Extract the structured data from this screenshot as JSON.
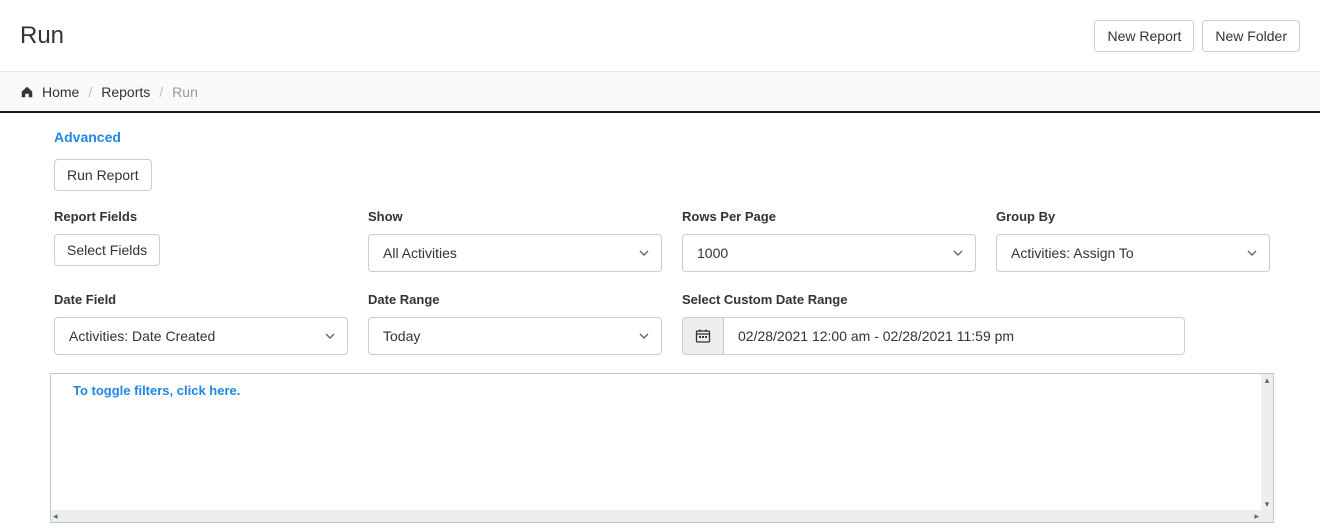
{
  "page_title": "Run",
  "topbar": {
    "new_report_label": "New Report",
    "new_folder_label": "New Folder"
  },
  "breadcrumb": {
    "home": "Home",
    "reports": "Reports",
    "current": "Run"
  },
  "form": {
    "advanced_label": "Advanced",
    "run_report_label": "Run Report",
    "report_fields": {
      "label": "Report Fields",
      "button": "Select Fields"
    },
    "show": {
      "label": "Show",
      "value": "All Activities"
    },
    "rows_per_page": {
      "label": "Rows Per Page",
      "value": "1000"
    },
    "group_by": {
      "label": "Group By",
      "value": "Activities: Assign To"
    },
    "date_field": {
      "label": "Date Field",
      "value": "Activities: Date Created"
    },
    "date_range": {
      "label": "Date Range",
      "value": "Today"
    },
    "custom_date_range": {
      "label": "Select Custom Date Range",
      "value": "02/28/2021 12:00 am - 02/28/2021 11:59 pm"
    }
  },
  "filters": {
    "toggle_text": "To toggle filters, click here."
  }
}
